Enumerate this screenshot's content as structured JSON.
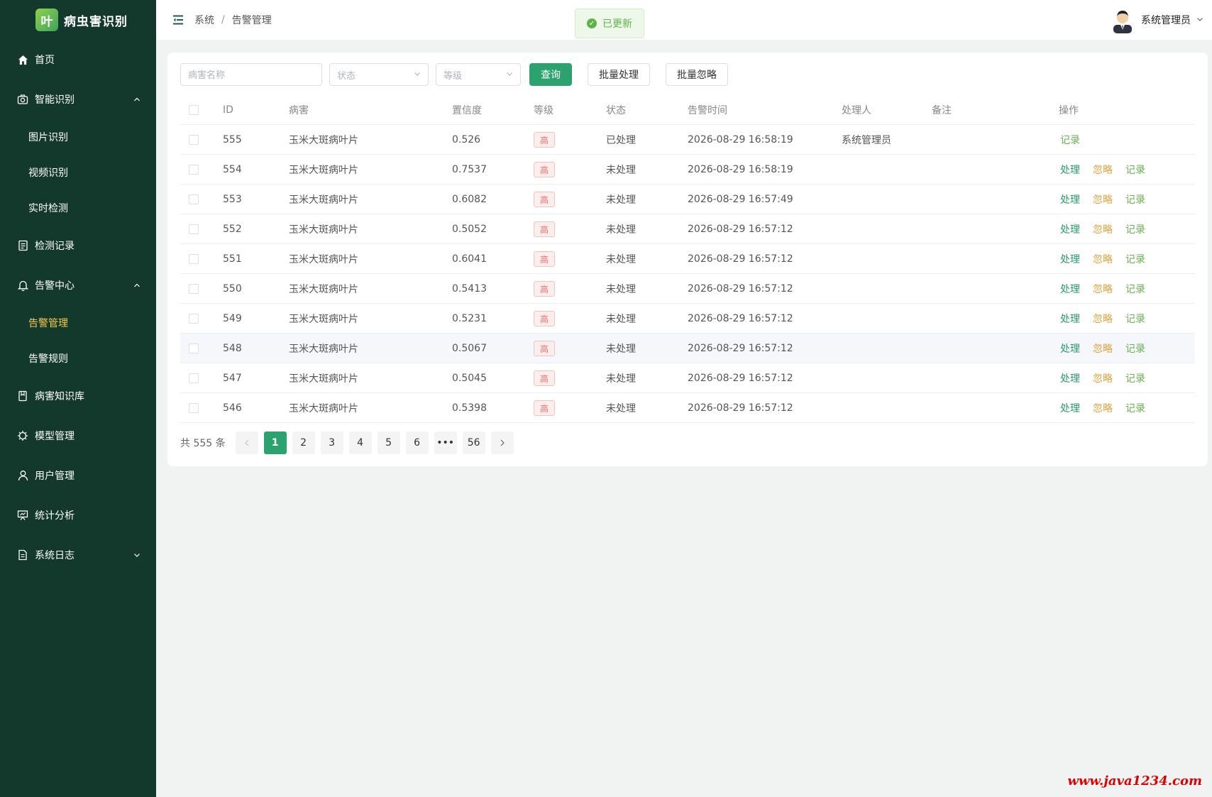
{
  "app": {
    "logo_char": "叶",
    "title": "病虫害识别"
  },
  "sidebar": {
    "items": [
      {
        "label": "首页",
        "icon": "home-icon"
      },
      {
        "label": "智能识别",
        "icon": "camera-icon",
        "expanded": true,
        "children": [
          "图片识别",
          "视频识别",
          "实时检测"
        ]
      },
      {
        "label": "检测记录",
        "icon": "document-icon"
      },
      {
        "label": "告警中心",
        "icon": "bell-icon",
        "expanded": true,
        "children": [
          "告警管理",
          "告警规则"
        ],
        "active_child": "告警管理"
      },
      {
        "label": "病害知识库",
        "icon": "book-icon"
      },
      {
        "label": "模型管理",
        "icon": "chip-icon"
      },
      {
        "label": "用户管理",
        "icon": "user-icon"
      },
      {
        "label": "统计分析",
        "icon": "presentation-icon"
      },
      {
        "label": "系统日志",
        "icon": "file-icon",
        "expanded": false
      }
    ]
  },
  "header": {
    "breadcrumb": [
      "系统",
      "告警管理"
    ],
    "toast": "已更新",
    "user_name": "系统管理员"
  },
  "filters": {
    "name_placeholder": "病害名称",
    "status_placeholder": "状态",
    "level_placeholder": "等级",
    "query_label": "查询",
    "batch_process_label": "批量处理",
    "batch_ignore_label": "批量忽略"
  },
  "table": {
    "columns": [
      "ID",
      "病害",
      "置信度",
      "等级",
      "状态",
      "告警时间",
      "处理人",
      "备注",
      "操作"
    ],
    "actions": {
      "process": "处理",
      "ignore": "忽略",
      "record": "记录"
    },
    "rows": [
      {
        "id": "555",
        "disease": "玉米大斑病叶片",
        "confidence": "0.526",
        "level": "高",
        "status": "已处理",
        "time": "2026-08-29 16:58:19",
        "handler": "系统管理员",
        "note": "",
        "handled": true
      },
      {
        "id": "554",
        "disease": "玉米大斑病叶片",
        "confidence": "0.7537",
        "level": "高",
        "status": "未处理",
        "time": "2026-08-29 16:58:19",
        "handler": "",
        "note": "",
        "handled": false
      },
      {
        "id": "553",
        "disease": "玉米大斑病叶片",
        "confidence": "0.6082",
        "level": "高",
        "status": "未处理",
        "time": "2026-08-29 16:57:49",
        "handler": "",
        "note": "",
        "handled": false
      },
      {
        "id": "552",
        "disease": "玉米大斑病叶片",
        "confidence": "0.5052",
        "level": "高",
        "status": "未处理",
        "time": "2026-08-29 16:57:12",
        "handler": "",
        "note": "",
        "handled": false
      },
      {
        "id": "551",
        "disease": "玉米大斑病叶片",
        "confidence": "0.6041",
        "level": "高",
        "status": "未处理",
        "time": "2026-08-29 16:57:12",
        "handler": "",
        "note": "",
        "handled": false
      },
      {
        "id": "550",
        "disease": "玉米大斑病叶片",
        "confidence": "0.5413",
        "level": "高",
        "status": "未处理",
        "time": "2026-08-29 16:57:12",
        "handler": "",
        "note": "",
        "handled": false
      },
      {
        "id": "549",
        "disease": "玉米大斑病叶片",
        "confidence": "0.5231",
        "level": "高",
        "status": "未处理",
        "time": "2026-08-29 16:57:12",
        "handler": "",
        "note": "",
        "handled": false
      },
      {
        "id": "548",
        "disease": "玉米大斑病叶片",
        "confidence": "0.5067",
        "level": "高",
        "status": "未处理",
        "time": "2026-08-29 16:57:12",
        "handler": "",
        "note": "",
        "handled": false
      },
      {
        "id": "547",
        "disease": "玉米大斑病叶片",
        "confidence": "0.5045",
        "level": "高",
        "status": "未处理",
        "time": "2026-08-29 16:57:12",
        "handler": "",
        "note": "",
        "handled": false
      },
      {
        "id": "546",
        "disease": "玉米大斑病叶片",
        "confidence": "0.5398",
        "level": "高",
        "status": "未处理",
        "time": "2026-08-29 16:57:12",
        "handler": "",
        "note": "",
        "handled": false
      }
    ]
  },
  "pagination": {
    "total_text": "共 555 条",
    "pages": [
      "1",
      "2",
      "3",
      "4",
      "5",
      "6",
      "•••",
      "56"
    ],
    "current": "1"
  },
  "watermark": "www.java1234.com",
  "colors": {
    "sidebar_bg": "#13392c",
    "primary": "#2ca36e",
    "active_menu": "#f7c948",
    "tag_red": "#f56c6c"
  }
}
